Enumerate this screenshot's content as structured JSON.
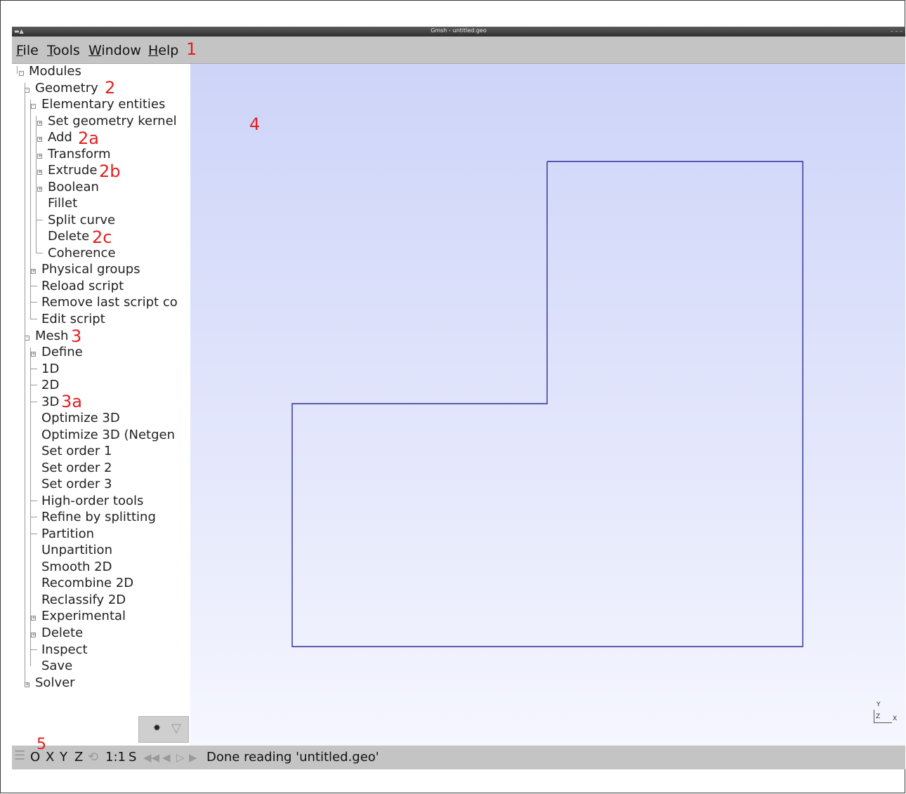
{
  "window": {
    "title": "Gmsh - untitled.geo"
  },
  "menu": [
    {
      "mnemonic": "F",
      "rest": "ile"
    },
    {
      "mnemonic": "T",
      "rest": "ools"
    },
    {
      "mnemonic": "W",
      "rest": "indow"
    },
    {
      "mnemonic": "H",
      "rest": "elp"
    }
  ],
  "annotations": {
    "menu": "1",
    "geometry": "2",
    "add": "2a",
    "extrude": "2b",
    "delete": "2c",
    "mesh": "3",
    "mesh3d": "3a",
    "viewport": "4",
    "statusbar": "5"
  },
  "tree": {
    "root": "Modules",
    "geometry": {
      "label": "Geometry",
      "elementary": "Elementary entities",
      "elementary_items": [
        "Set geometry kernel",
        "Add",
        "Transform",
        "Extrude",
        "Boolean",
        "Fillet",
        "Split curve",
        "Delete",
        "Coherence"
      ],
      "rest": [
        "Physical groups",
        "Reload script",
        "Remove last script co",
        "Edit script"
      ]
    },
    "mesh": {
      "label": "Mesh",
      "items": [
        "Define",
        "1D",
        "2D",
        "3D",
        "Optimize 3D",
        "Optimize 3D (Netgen",
        "Set order 1",
        "Set order 2",
        "Set order 3",
        "High-order tools",
        "Refine by splitting",
        "Partition",
        "Unpartition",
        "Smooth 2D",
        "Recombine 2D",
        "Reclassify 2D",
        "Experimental",
        "Delete",
        "Inspect",
        "Save"
      ]
    },
    "solver": "Solver"
  },
  "viewport": {
    "shape_color": "#2b2b9a",
    "axes": {
      "y": "Y",
      "z": "Z",
      "x": "X"
    }
  },
  "statusbar": {
    "buttons": [
      "O",
      "X",
      "Y",
      "Z"
    ],
    "scale": "1:1",
    "s": "S",
    "message": "Done reading 'untitled.geo'"
  }
}
